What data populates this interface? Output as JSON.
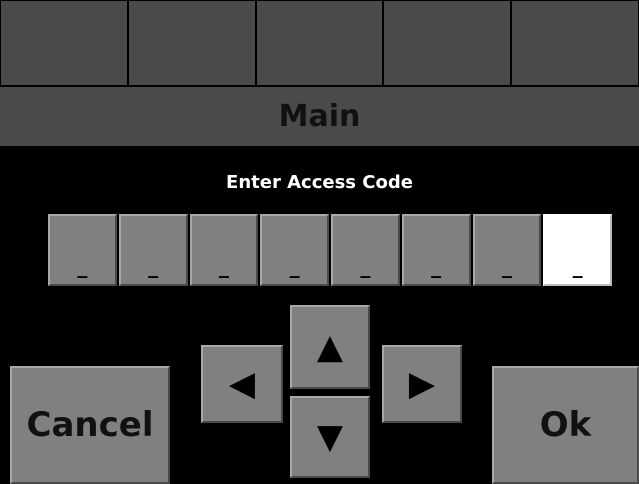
{
  "top_tabs": [
    "",
    "",
    "",
    "",
    ""
  ],
  "title": "Main",
  "prompt": "Enter Access Code",
  "code_cells": [
    "_",
    "_",
    "_",
    "_",
    "_",
    "_",
    "_",
    "_"
  ],
  "active_cell_index": 7,
  "buttons": {
    "cancel": "Cancel",
    "ok": "Ok"
  },
  "icons": {
    "left": "◀",
    "up": "▲",
    "down": "▼",
    "right": "▶"
  },
  "colors": {
    "background": "#000000",
    "button_gray": "#808080",
    "header_gray": "#4a4a4a",
    "active_cell": "#ffffff"
  }
}
